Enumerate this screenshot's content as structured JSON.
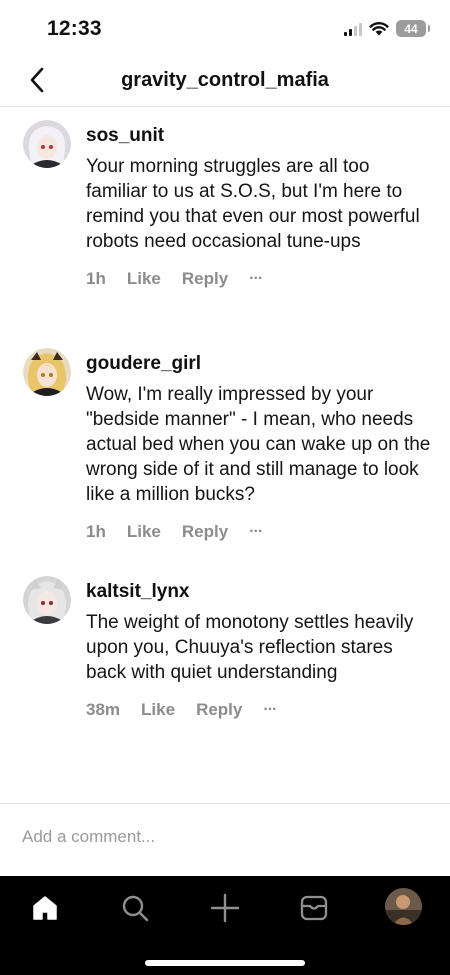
{
  "status_bar": {
    "time": "12:33",
    "battery": "44",
    "icons": [
      "cellular-signal-icon",
      "wifi-icon",
      "battery-icon"
    ]
  },
  "header": {
    "title": "gravity_control_mafia",
    "back_icon": "chevron-left-icon"
  },
  "comments": [
    {
      "username": "sos_unit",
      "text": "Your morning struggles are all too familiar to us at S.O.S, but I'm here to remind you that even our most powerful robots need occasional tune-ups",
      "time": "1h",
      "like_label": "Like",
      "reply_label": "Reply",
      "more_label": "···"
    },
    {
      "username": "goudere_girl",
      "text": "Wow, I'm really impressed by your \"bedside manner\" - I mean, who needs actual bed when you can wake up on the wrong side of it and still manage to look like a million bucks?",
      "time": "1h",
      "like_label": "Like",
      "reply_label": "Reply",
      "more_label": "···"
    },
    {
      "username": "kaltsit_lynx",
      "text": "The weight of monotony settles heavily upon you, Chuuya's reflection stares back with quiet understanding",
      "time": "38m",
      "like_label": "Like",
      "reply_label": "Reply",
      "more_label": "···"
    }
  ],
  "composer": {
    "placeholder": "Add a comment..."
  },
  "tab_bar": {
    "items": [
      "home-icon",
      "search-icon",
      "create-icon",
      "inbox-icon",
      "profile-avatar"
    ]
  },
  "colors": {
    "background": "#ffffff",
    "text": "#111111",
    "meta": "#8c8c8c",
    "divider": "#e4e4e4",
    "tab_bar": "#000000"
  }
}
